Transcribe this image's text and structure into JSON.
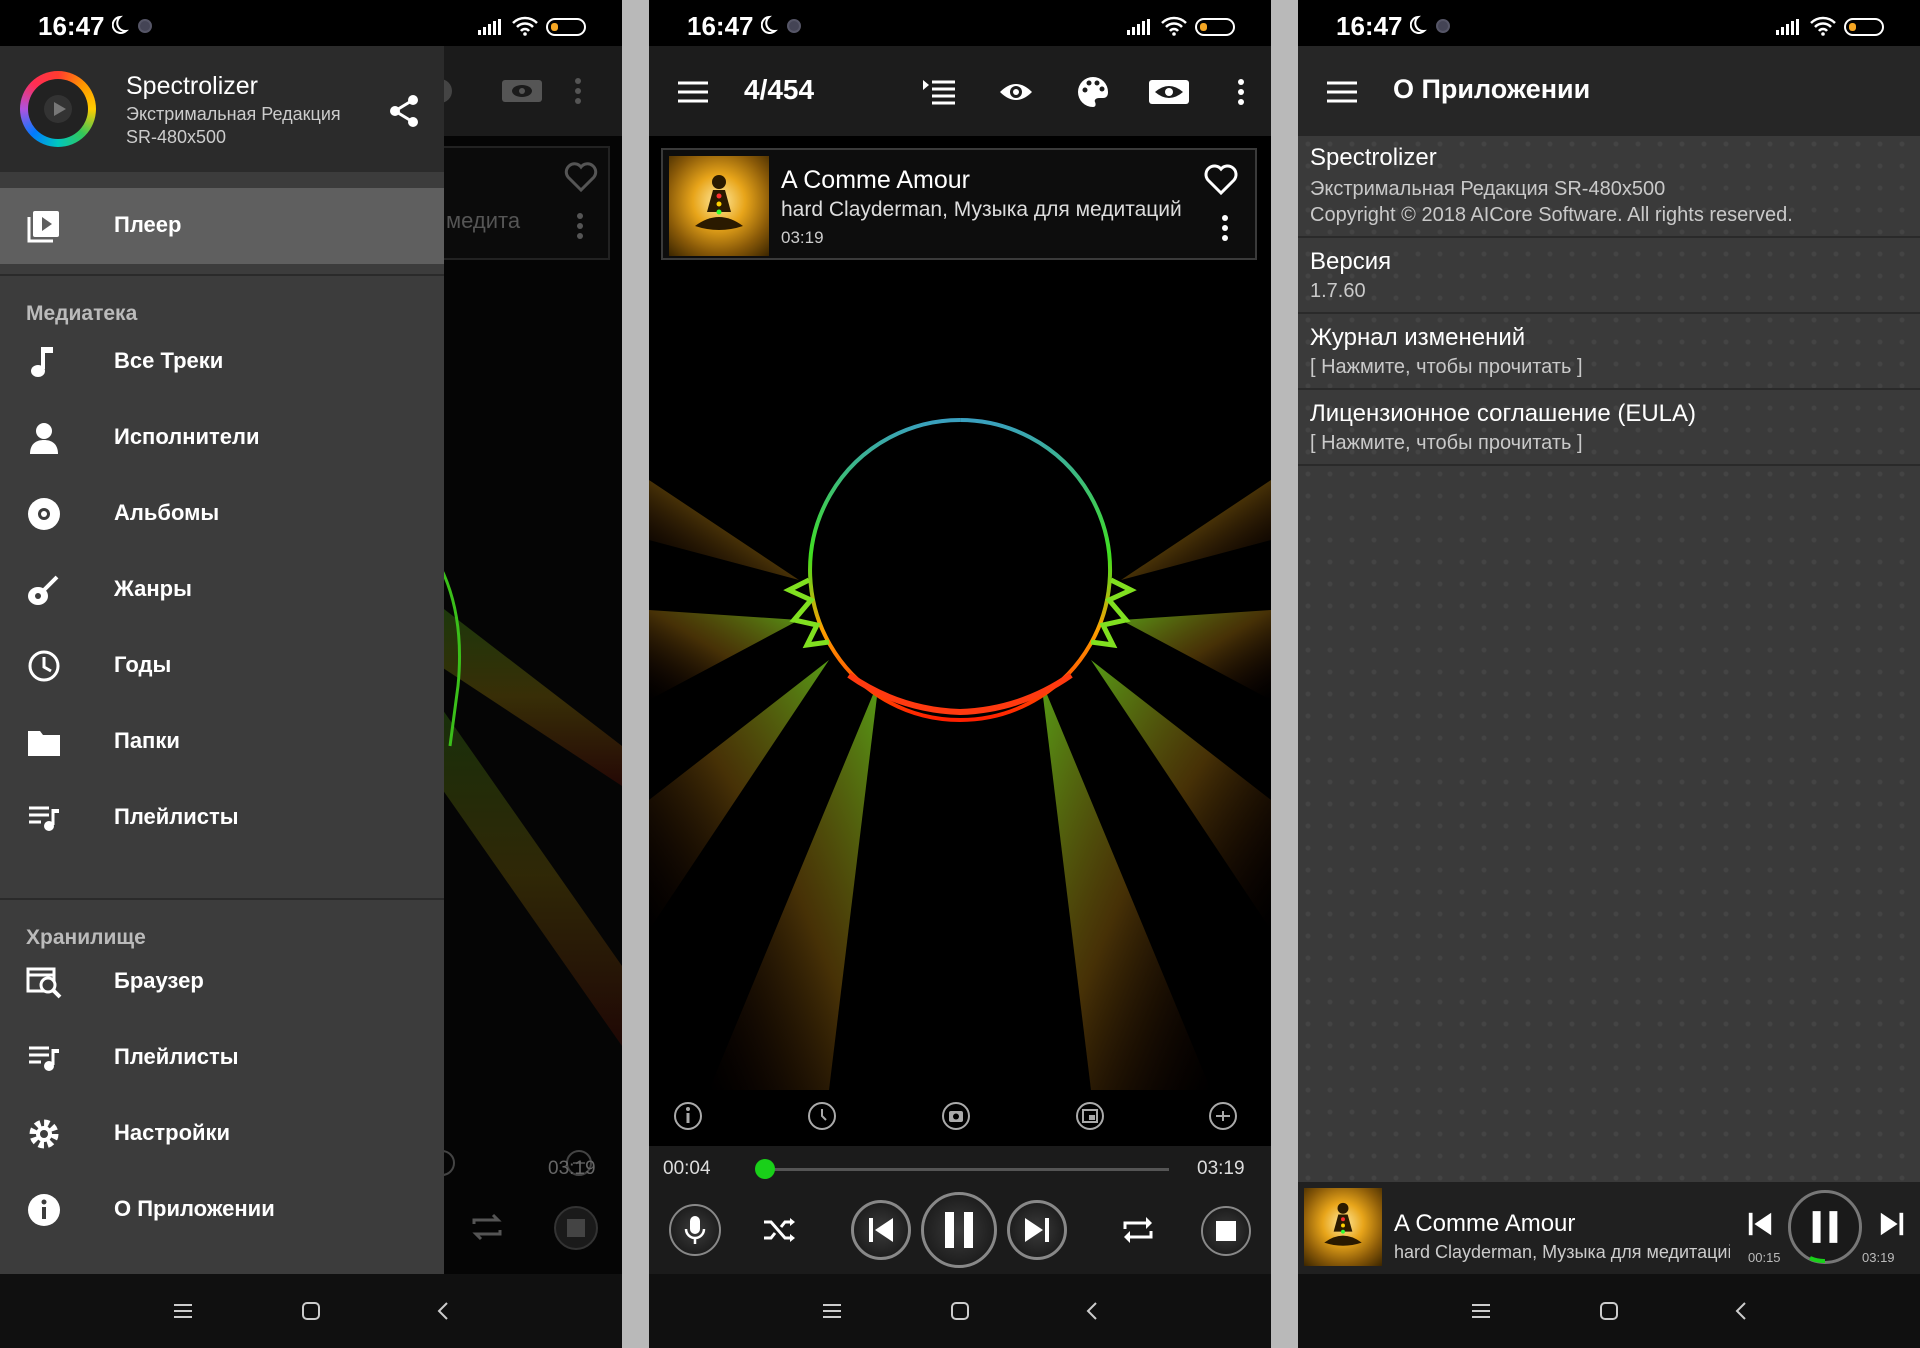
{
  "status": {
    "time": "16:47"
  },
  "drawer": {
    "app_name": "Spectrolizer",
    "edition": "Экстримальная Редакция",
    "model": "SR-480x500",
    "active_item": "Плеер",
    "section_library": "Медиатека",
    "library_items": [
      "Все Треки",
      "Исполнители",
      "Альбомы",
      "Жанры",
      "Годы",
      "Папки",
      "Плейлисты"
    ],
    "section_storage": "Хранилище",
    "storage_items": [
      "Браузер",
      "Плейлисты",
      "Настройки",
      "О Приложении"
    ],
    "bg_card_text": "медита",
    "bg_time": "03:19"
  },
  "player": {
    "counter": "4/454",
    "track": {
      "title": "A Comme Amour",
      "artist": "hard Clayderman, Музыка для медитаций",
      "duration": "03:19"
    },
    "elapsed": "00:04",
    "total": "03:19",
    "progress": 0.02
  },
  "about": {
    "title": "О Приложении",
    "app_name": "Spectrolizer",
    "edition_line": "Экстримальная Редакция SR-480x500",
    "copyright": "Copyright © 2018 AICore Software. All rights reserved.",
    "version_label": "Версия",
    "version_value": "1.7.60",
    "changelog_label": "Журнал изменений",
    "changelog_hint": "[ Нажмите, чтобы прочитать ]",
    "eula_label": "Лицензионное соглашение (EULA)",
    "eula_hint": "[ Нажмите, чтобы прочитать ]",
    "mini_title": "A Comme Amour",
    "mini_artist": "hard Clayderman, Музыка для медитаций",
    "mini_elapsed": "00:15",
    "mini_total": "03:19"
  },
  "icons": {
    "drawer": [
      "play-library-icon",
      "music-note-icon",
      "person-icon",
      "disc-icon",
      "guitar-icon",
      "clock-icon",
      "folder-icon",
      "playlist-icon",
      "browser-icon",
      "playlist-icon",
      "gear-icon",
      "info-icon"
    ]
  }
}
